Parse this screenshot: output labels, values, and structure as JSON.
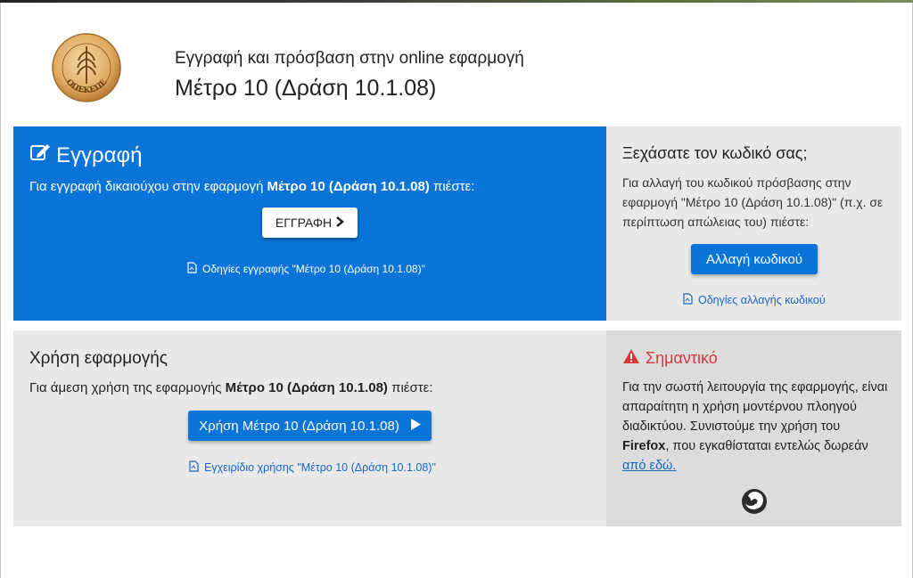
{
  "header": {
    "subtitle": "Εγγραφή και πρόσβαση στην online εφαρμογή",
    "title": "Μέτρο 10 (Δράση 10.1.08)",
    "logo_text": "ΟΠΕΚΕΠΕ"
  },
  "register": {
    "title": "Εγγραφή",
    "text_before": "Για εγγραφή δικαιούχου στην εφαρμογή ",
    "text_bold": "Μέτρο 10 (Δράση 10.1.08)",
    "text_after": " πιέστε:",
    "button_label": "ΕΓΓΡΑΦΗ",
    "guide_link": "Οδηγίες εγγραφής \"Μέτρο 10 (Δράση 10.1.08)\""
  },
  "forgot": {
    "title": "Ξεχάσατε τον κωδικό σας;",
    "text": "Για αλλαγή του κωδικού πρόσβασης στην εφαρμογή \"Μέτρο 10 (Δράση 10.1.08)\" (π.χ. σε περίπτωση απώλειας του) πιέστε:",
    "button_label": "Αλλαγή κωδικού",
    "guide_link": "Οδηγίες αλλαγής κωδικού"
  },
  "use": {
    "title": "Χρήση εφαρμογής",
    "text_before": "Για άμεση χρήση της εφαρμογής ",
    "text_bold": "Μέτρο 10 (Δράση 10.1.08)",
    "text_after": " πιέστε:",
    "button_label": "Χρήση Μέτρο 10 (Δράση 10.1.08)",
    "manual_link": "Εγχειρίδιο χρήσης \"Μέτρο 10 (Δράση 10.1.08)\""
  },
  "important": {
    "title": "Σημαντικό",
    "text_before": "Για την σωστή λειτουργία της εφαρμογής, είναι απαραίτητη η χρήση μοντέρνου πλοηγού διαδικτύου. Συνιστούμε την χρήση του ",
    "text_bold": "Firefox",
    "text_after": ", που εγκαθίσταται εντελώς δωρεάν ",
    "link_text": "από εδώ."
  },
  "colors": {
    "primary_blue": "#0a74d9",
    "panel_gray": "#e9e9ea",
    "important_red": "#d9363e",
    "link_blue": "#1767c6"
  },
  "icons": {
    "register": "edit-icon",
    "chevron": "chevron-right-icon",
    "pdf": "pdf-file-icon",
    "play": "play-icon",
    "warning": "warning-icon",
    "firefox": "firefox-icon"
  }
}
